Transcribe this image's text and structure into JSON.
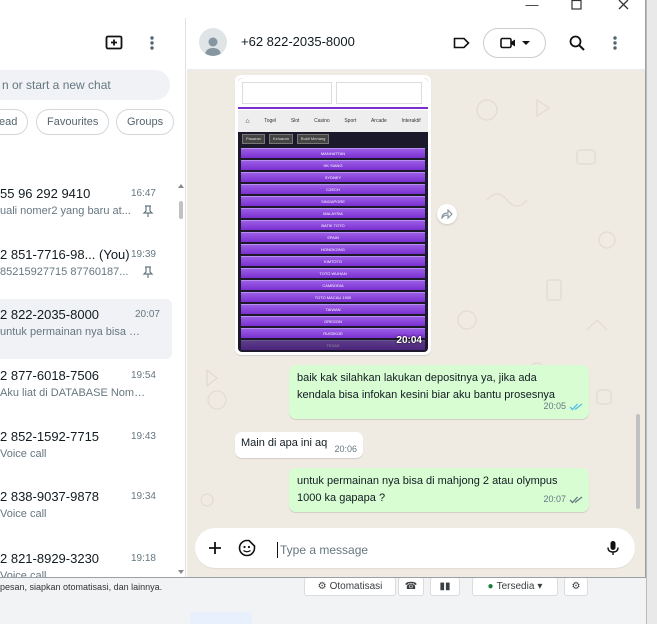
{
  "left_panel": {
    "search_placeholder": "n or start a new chat",
    "filters": [
      "ead",
      "Favourites",
      "Groups"
    ],
    "chats": [
      {
        "name": "55 96 292 9410",
        "time": "16:47",
        "preview": "uali nomer2 yang baru at...",
        "pinned": true
      },
      {
        "name": "2 851-7716-98... (You)",
        "time": "19:39",
        "preview": "85215927715 87760187...",
        "pinned": true
      },
      {
        "name": "2 822-2035-8000",
        "time": "20:07",
        "preview": "untuk permainan nya bisa di ...",
        "pinned": false
      },
      {
        "name": "2 877-6018-7506",
        "time": "19:54",
        "preview": "Aku liat di DATABASE Nomer...",
        "pinned": false
      },
      {
        "name": "2 852-1592-7715",
        "time": "19:43",
        "preview": "Voice call",
        "pinned": false
      },
      {
        "name": "2 838-9037-9878",
        "time": "19:34",
        "preview": "Voice call",
        "pinned": false
      },
      {
        "name": "2 821-8929-3230",
        "time": "19:18",
        "preview": "Voice call",
        "pinned": false
      }
    ]
  },
  "chat": {
    "contact_name": "+62 822-2035-8000",
    "image_time": "20:04",
    "screenshot": {
      "nav_tabs": [
        "Togel",
        "Slot",
        "Casino",
        "Sport",
        "Arcade",
        "Interaktif"
      ],
      "buttons": [
        "Pasaran",
        "Keluaran",
        "Bukti Menang"
      ],
      "rows": [
        "MANHATTAN",
        "HK SIANG",
        "SYDNEY",
        "CZECH",
        "SINGAPORE",
        "MALAYSIA",
        "BATIK TOTO",
        "SPAIN",
        "HONGKONG",
        "KIMTOTO",
        "TOTO WUHAN",
        "CAMBODIA",
        "TOTO MACAU 1900",
        "TAIWAN",
        "OREGON",
        "RUSSKOE",
        "TEXAS"
      ]
    },
    "messages": [
      {
        "dir": "out",
        "text_line1": "baik kak silahkan lakukan depositnya ya, jika ada",
        "text_line2": "kendala bisa infokan kesini biar aku bantu prosesnya",
        "time": "20:05"
      },
      {
        "dir": "in",
        "text": "Main di apa ini aq",
        "time": "20:06"
      },
      {
        "dir": "out",
        "text_line1": "untuk permainan nya bisa di mahjong 2 atau olympus",
        "text_line2": "1000 ka gapapa ?",
        "time": "20:07"
      }
    ],
    "composer_placeholder": "Type a message"
  },
  "background_app": {
    "description_text": "pesan, siapkan otomatisasi, dan lainnya.",
    "automation_label": "Otomatisasi",
    "status_label": "Tersedia"
  },
  "colors": {
    "outgoing_bubble": "#d9fdd3",
    "chat_background": "#efeae2",
    "read_ticks": "#53bdeb"
  }
}
